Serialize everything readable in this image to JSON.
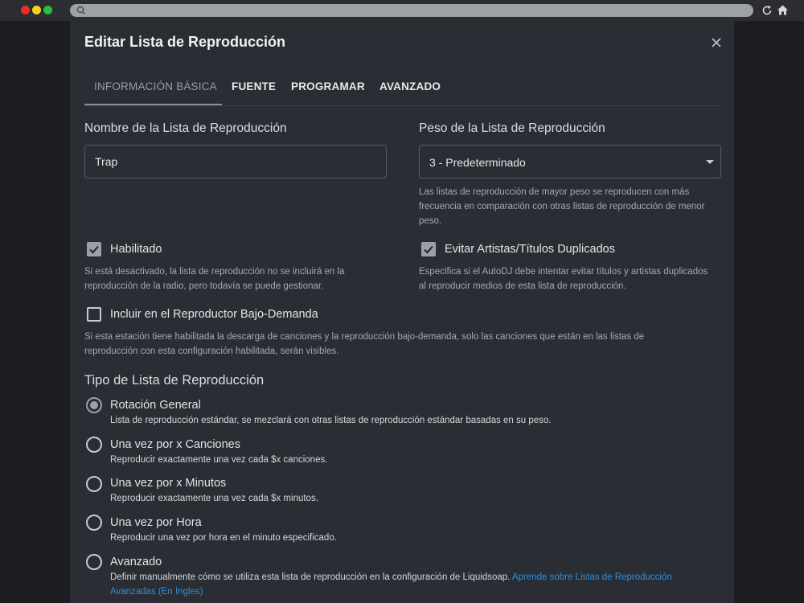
{
  "modal": {
    "title": "Editar Lista de Reproducción"
  },
  "tabs": [
    {
      "label": "INFORMACIÓN BÁSICA",
      "active": true
    },
    {
      "label": "FUENTE",
      "active": false
    },
    {
      "label": "PROGRAMAR",
      "active": false
    },
    {
      "label": "AVANZADO",
      "active": false
    }
  ],
  "name_field": {
    "label": "Nombre de la Lista de Reproducción",
    "value": "Trap"
  },
  "weight_field": {
    "label": "Peso de la Lista de Reproducción",
    "selected": "3 - Predeterminado",
    "help": "Las listas de reproducción de mayor peso se reproducen con más frecuencia en comparación con otras listas de reproducción de menor peso."
  },
  "enabled": {
    "label": "Habilitado",
    "checked": true,
    "help": "Si está desactivado, la lista de reproducción no se incluirá en la reproducción de la radio, pero todavía se puede gestionar."
  },
  "avoid_duplicates": {
    "label": "Evitar Artistas/Títulos Duplicados",
    "checked": true,
    "help": "Especifica si el AutoDJ debe intentar evitar títulos y artistas duplicados al reproducir medios de esta lista de reproducción."
  },
  "on_demand": {
    "label": "Incluir en el Reproductor Bajo-Demanda",
    "checked": false,
    "help": "Si esta estación tiene habilitada la descarga de canciones y la reproducción bajo-demanda, solo las canciones que están en las listas de reproducción con esta configuración habilitada, serán visibles."
  },
  "playlist_type": {
    "title": "Tipo de Lista de Reproducción",
    "options": [
      {
        "label": "Rotación General",
        "desc": "Lista de reproducción estándar, se mezclará con otras listas de reproducción estándar basadas en su peso.",
        "selected": true
      },
      {
        "label": "Una vez por x Canciones",
        "desc": "Reproducir exactamente una vez cada $x canciones.",
        "selected": false
      },
      {
        "label": "Una vez por x Minutos",
        "desc": "Reproducir exactamente una vez cada $x minutos.",
        "selected": false
      },
      {
        "label": "Una vez por Hora",
        "desc": "Reproducir una vez por hora en el minuto especificado.",
        "selected": false
      },
      {
        "label": "Avanzado",
        "desc": "Definir manualmente cómo se utiliza esta lista de reproducción en la configuración de Liquidsoap.",
        "link": "Aprende sobre Listas de Reproducción Avanzadas (En Ingles)",
        "selected": false
      }
    ]
  },
  "colors": {
    "background": "#1e2126",
    "modal": "#2a2d33",
    "link": "#2f8fe0",
    "traffic_red": "#ee2b2b",
    "traffic_yellow": "#f3d21c",
    "traffic_green": "#25c13c"
  },
  "icons": [
    "search-icon",
    "reload-icon",
    "home-icon",
    "close-icon",
    "chevron-down-icon",
    "check-icon"
  ]
}
